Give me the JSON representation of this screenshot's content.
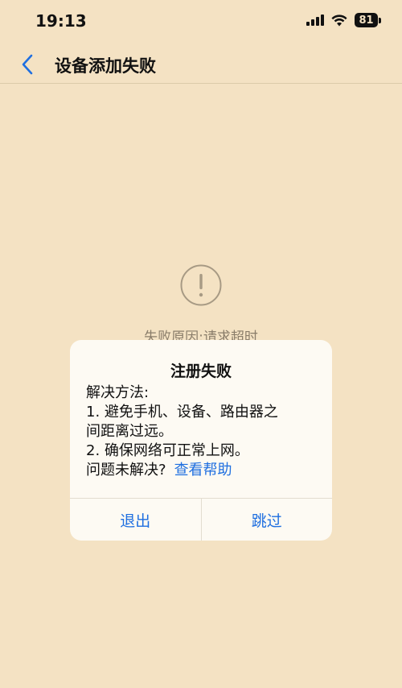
{
  "status_bar": {
    "time": "19:13",
    "battery": "81",
    "icons": [
      "signal-icon",
      "wifi-icon",
      "battery-icon"
    ]
  },
  "nav": {
    "back_icon": "chevron-left-icon",
    "title": "设备添加失败"
  },
  "page": {
    "alert_icon": "exclamation-circle-icon",
    "fail_reason": "失败原因:请求超时"
  },
  "dialog": {
    "title": "注册失败",
    "solution_label": "解决方法:",
    "step1_line1": "1. 避免手机、设备、路由器之",
    "step1_line2": "间距离过远。",
    "step2": "2. 确保网络可正常上网。",
    "unresolved_label": "问题未解决?",
    "help_link": "查看帮助",
    "exit_button": "退出",
    "skip_button": "跳过"
  },
  "colors": {
    "background": "#f4e2c3",
    "accent": "#1f6fe0",
    "dialog_bg": "#fdfaf3"
  }
}
